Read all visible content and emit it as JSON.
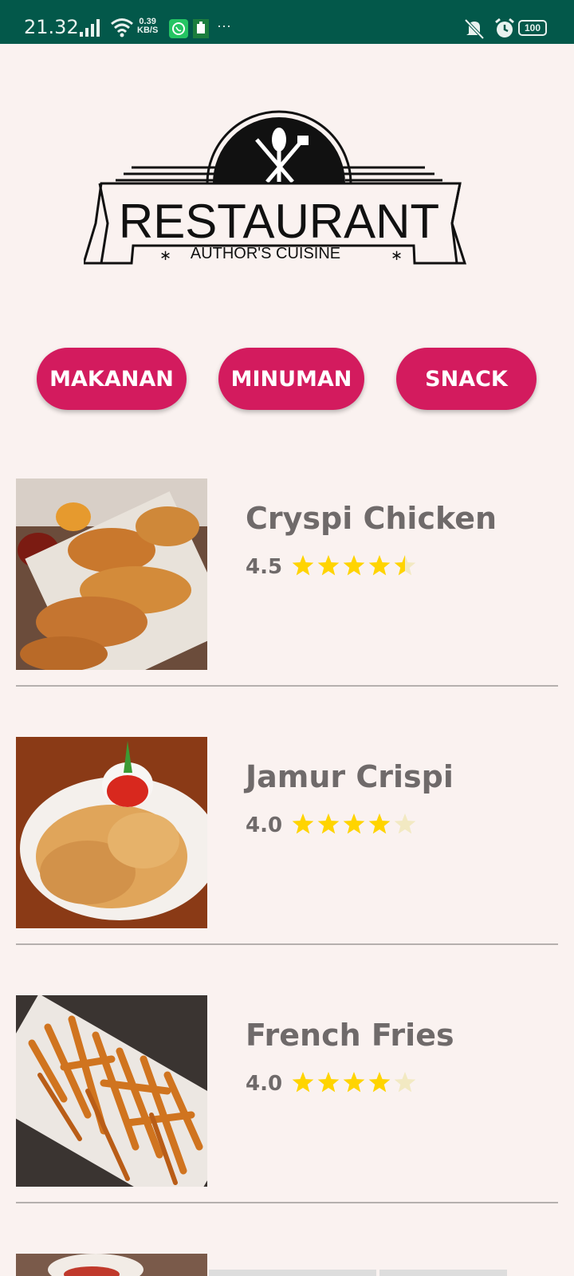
{
  "status_bar": {
    "time": "21.32",
    "net_speed_value": "0.39",
    "net_speed_unit": "KB/S",
    "more": "···",
    "battery": "100",
    "icons": [
      "signal-icon",
      "wifi-icon",
      "whatsapp-icon",
      "app-icon",
      "mute-icon",
      "alarm-icon",
      "battery-icon"
    ]
  },
  "logo": {
    "title": "RESTAURANT",
    "subtitle": "AUTHOR'S CUISINE",
    "icon": "fork-spoon-icon"
  },
  "categories": [
    {
      "label": "MAKANAN"
    },
    {
      "label": "MINUMAN"
    },
    {
      "label": "SNACK"
    }
  ],
  "colors": {
    "accent": "#d31b5e",
    "status_bar": "#03584a",
    "background": "#faf2f0",
    "star": "#ffd400",
    "star_empty": "#f2e9c2",
    "text": "#6f6a6a"
  },
  "menu": [
    {
      "name": "Cryspi Chicken",
      "rating": "4.5",
      "rating_value": 4.5,
      "image": "crispy-chicken-photo"
    },
    {
      "name": "Jamur Crispi",
      "rating": "4.0",
      "rating_value": 4.0,
      "image": "crispy-mushroom-photo"
    },
    {
      "name": "French Fries",
      "rating": "4.0",
      "rating_value": 4.0,
      "image": "french-fries-photo"
    },
    {
      "image": "food-photo"
    }
  ]
}
